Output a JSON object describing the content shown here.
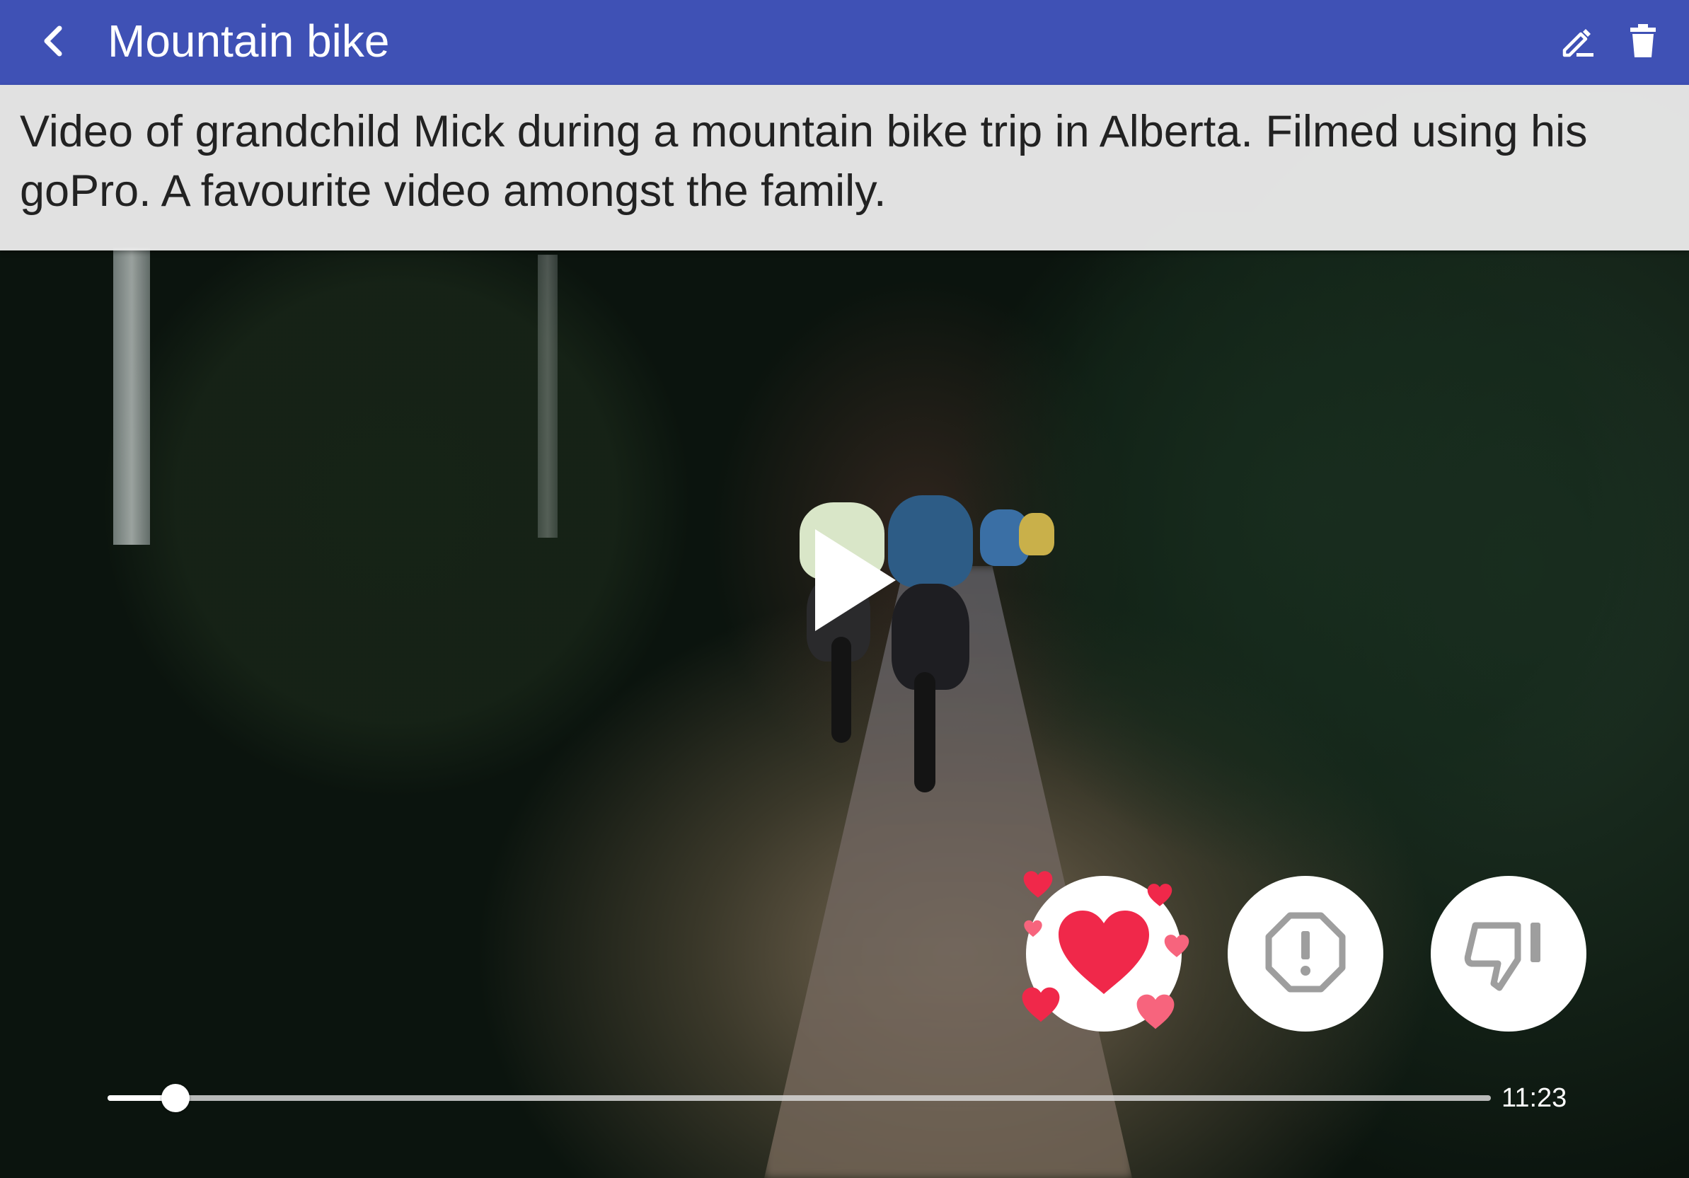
{
  "header": {
    "title": "Mountain bike",
    "back_icon": "chevron-left-icon",
    "edit_icon": "edit-pencil-icon",
    "delete_icon": "trash-icon",
    "bar_color": "#3f51b5"
  },
  "description": {
    "text": "Video of grandchild Mick during a mountain bike trip in Alberta. Filmed using his goPro. A favourite video amongst the family."
  },
  "player": {
    "play_icon": "play-icon",
    "duration": "11:23",
    "progress_fraction": 0.049
  },
  "actions": [
    {
      "name": "love",
      "icon": "heart-icon",
      "color": "#f0284a"
    },
    {
      "name": "report",
      "icon": "alert-octagon-icon",
      "color": "#9e9e9e"
    },
    {
      "name": "dislike",
      "icon": "thumb-down-icon",
      "color": "#9e9e9e"
    }
  ]
}
